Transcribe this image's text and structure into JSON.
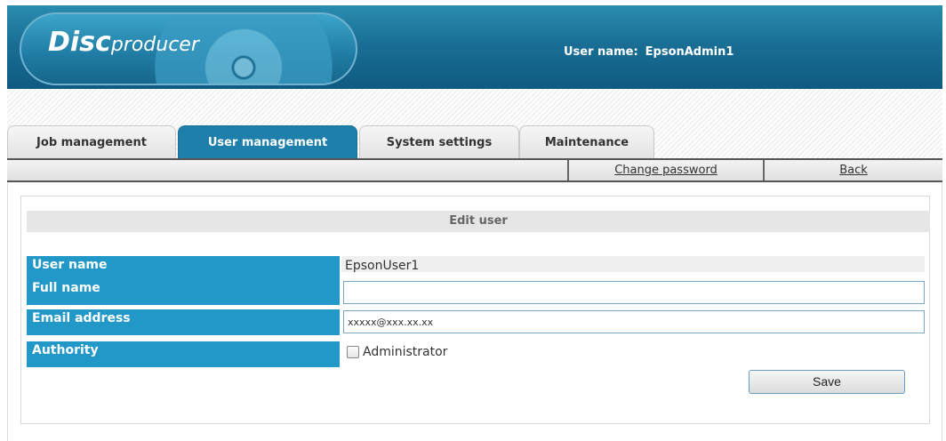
{
  "header": {
    "logo_disc": "Disc",
    "logo_producer": "producer",
    "user_label": "User name:",
    "user_value": "EpsonAdmin1"
  },
  "tabs": [
    {
      "label": "Job management",
      "active": false
    },
    {
      "label": "User management",
      "active": true
    },
    {
      "label": "System settings",
      "active": false
    },
    {
      "label": "Maintenance",
      "active": false
    }
  ],
  "subbar": {
    "change_password": "Change password",
    "back": "Back"
  },
  "panel": {
    "title": "Edit user"
  },
  "form": {
    "rows": [
      {
        "label": "User name",
        "value": "EpsonUser1"
      },
      {
        "label": "Full name",
        "value": ""
      },
      {
        "label": "Email address",
        "value": "xxxxx@xxx.xx.xx"
      },
      {
        "label": "Authority",
        "value": ""
      }
    ],
    "administrator_label": "Administrator",
    "administrator_checked": false,
    "save_label": "Save"
  },
  "colors": {
    "header_blue": "#1a6f96",
    "active_tab": "#1e7fab",
    "label_blue": "#2198c7"
  }
}
